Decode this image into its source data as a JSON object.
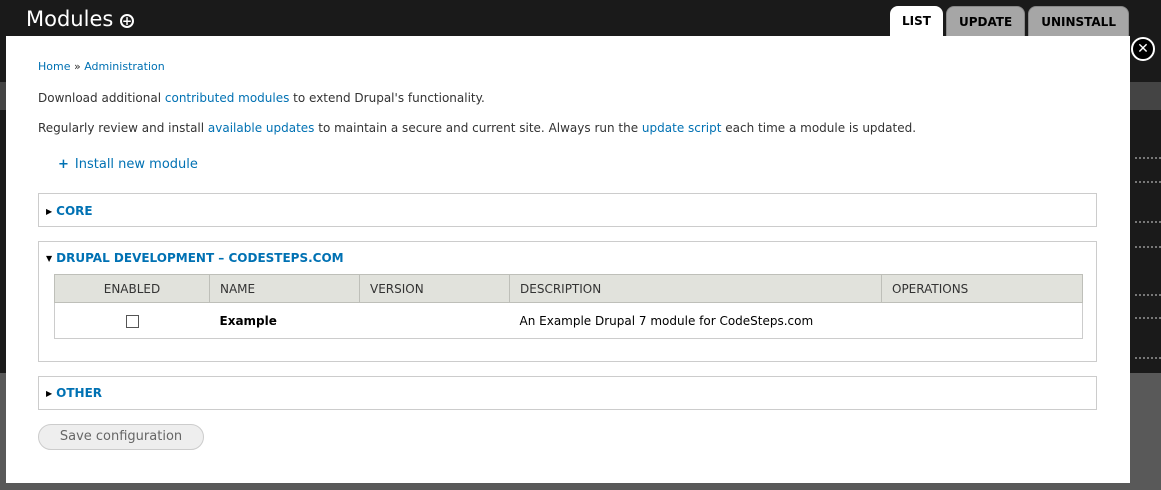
{
  "header": {
    "title": "Modules",
    "add_icon": "+"
  },
  "tabs": [
    {
      "label": "LIST"
    },
    {
      "label": "UPDATE"
    },
    {
      "label": "UNINSTALL"
    }
  ],
  "close_icon": "✕",
  "breadcrumb": {
    "home": "Home",
    "separator": " » ",
    "admin": "Administration"
  },
  "intro": {
    "p1_before": "Download additional ",
    "p1_link": "contributed modules",
    "p1_after": " to extend Drupal's functionality.",
    "p2_before": "Regularly review and install ",
    "p2_link1": "available updates",
    "p2_mid": " to maintain a secure and current site. Always run the ",
    "p2_link2": "update script",
    "p2_after": " each time a module is updated."
  },
  "install_link": {
    "plus": "+",
    "label": "Install new module"
  },
  "fieldsets": {
    "core": {
      "label": "CORE",
      "collapsed": true
    },
    "drupal_dev": {
      "label": "DRUPAL DEVELOPMENT – CODESTEPS.COM",
      "collapsed": false
    },
    "other": {
      "label": "OTHER",
      "collapsed": true
    }
  },
  "table": {
    "headers": {
      "enabled": "ENABLED",
      "name": "NAME",
      "version": "VERSION",
      "description": "DESCRIPTION",
      "operations": "OPERATIONS"
    },
    "rows": [
      {
        "enabled": false,
        "name": "Example",
        "version": "",
        "description": "An Example Drupal 7 module for CodeSteps.com",
        "operations": ""
      }
    ]
  },
  "save_button": "Save configuration",
  "colors": {
    "link": "#0071b3",
    "header_bg": "#e1e2dc"
  }
}
